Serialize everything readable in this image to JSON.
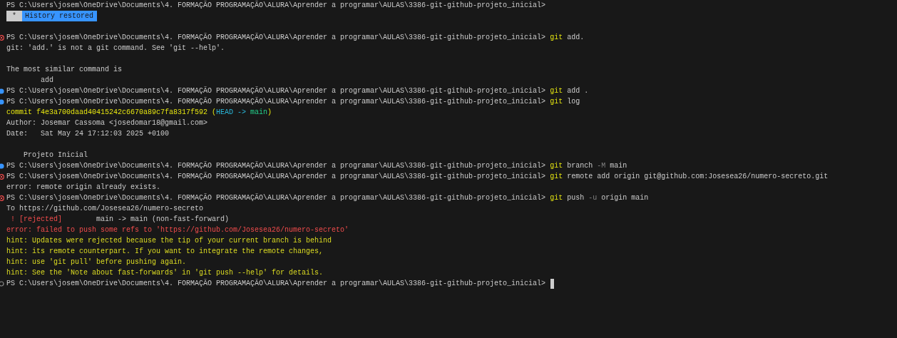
{
  "terminal": {
    "lines": [
      {
        "kind": "prompt",
        "prompt": "PS C:\\Users\\josem\\OneDrive\\Documents\\4. FORMAÇÃO PROGRAMAÇÃO\\ALURA\\Aprender a programar\\AULAS\\3386-git-github-projeto_inicial>"
      },
      {
        "kind": "badge",
        "marker": "*",
        "label": "History restored"
      },
      {
        "kind": "blank"
      },
      {
        "kind": "prompt",
        "decoration": {
          "kind": "error"
        },
        "prompt": "PS C:\\Users\\josem\\OneDrive\\Documents\\4. FORMAÇÃO PROGRAMAÇÃO\\ALURA\\Aprender a programar\\AULAS\\3386-git-github-projeto_inicial>",
        "segments": [
          {
            "text": "git",
            "kind": "command"
          },
          {
            "text": " add.",
            "kind": "default"
          }
        ]
      },
      {
        "kind": "output",
        "segments": [
          {
            "text": "git: 'add.' is not a git command. See 'git --help'.",
            "kind": "default"
          }
        ]
      },
      {
        "kind": "blank"
      },
      {
        "kind": "output",
        "segments": [
          {
            "text": "The most similar command is",
            "kind": "default"
          }
        ]
      },
      {
        "kind": "output",
        "segments": [
          {
            "text": "        add",
            "kind": "default"
          }
        ]
      },
      {
        "kind": "prompt",
        "decoration": {
          "kind": "success"
        },
        "prompt": "PS C:\\Users\\josem\\OneDrive\\Documents\\4. FORMAÇÃO PROGRAMAÇÃO\\ALURA\\Aprender a programar\\AULAS\\3386-git-github-projeto_inicial>",
        "segments": [
          {
            "text": "git",
            "kind": "command"
          },
          {
            "text": " add .",
            "kind": "default"
          }
        ]
      },
      {
        "kind": "prompt",
        "decoration": {
          "kind": "success"
        },
        "prompt": "PS C:\\Users\\josem\\OneDrive\\Documents\\4. FORMAÇÃO PROGRAMAÇÃO\\ALURA\\Aprender a programar\\AULAS\\3386-git-github-projeto_inicial>",
        "segments": [
          {
            "text": "git",
            "kind": "command"
          },
          {
            "text": " log",
            "kind": "default"
          }
        ]
      },
      {
        "kind": "output",
        "segments": [
          {
            "text": "commit f4e3a700daad40415242c6670a89c7fa8317f592 (",
            "kind": "commit"
          },
          {
            "text": "HEAD -> ",
            "kind": "head"
          },
          {
            "text": "main",
            "kind": "branch"
          },
          {
            "text": ")",
            "kind": "commit"
          }
        ]
      },
      {
        "kind": "output",
        "segments": [
          {
            "text": "Author: Josemar Cassoma <josedomar18@gmail.com>",
            "kind": "default"
          }
        ]
      },
      {
        "kind": "output",
        "segments": [
          {
            "text": "Date:   Sat May 24 17:12:03 2025 +0100",
            "kind": "default"
          }
        ]
      },
      {
        "kind": "blank"
      },
      {
        "kind": "output",
        "segments": [
          {
            "text": "    Projeto Inicial",
            "kind": "default"
          }
        ]
      },
      {
        "kind": "prompt",
        "decoration": {
          "kind": "success"
        },
        "prompt": "PS C:\\Users\\josem\\OneDrive\\Documents\\4. FORMAÇÃO PROGRAMAÇÃO\\ALURA\\Aprender a programar\\AULAS\\3386-git-github-projeto_inicial>",
        "segments": [
          {
            "text": "git",
            "kind": "command"
          },
          {
            "text": " branch ",
            "kind": "default"
          },
          {
            "text": "-M",
            "kind": "flag"
          },
          {
            "text": " main",
            "kind": "default"
          }
        ]
      },
      {
        "kind": "prompt",
        "decoration": {
          "kind": "error"
        },
        "prompt": "PS C:\\Users\\josem\\OneDrive\\Documents\\4. FORMAÇÃO PROGRAMAÇÃO\\ALURA\\Aprender a programar\\AULAS\\3386-git-github-projeto_inicial>",
        "segments": [
          {
            "text": "git",
            "kind": "command"
          },
          {
            "text": " remote add origin git@github.com:Josesea26/numero-secreto.git",
            "kind": "default"
          }
        ]
      },
      {
        "kind": "output",
        "segments": [
          {
            "text": "error: remote origin already exists.",
            "kind": "default"
          }
        ]
      },
      {
        "kind": "prompt",
        "decoration": {
          "kind": "error"
        },
        "prompt": "PS C:\\Users\\josem\\OneDrive\\Documents\\4. FORMAÇÃO PROGRAMAÇÃO\\ALURA\\Aprender a programar\\AULAS\\3386-git-github-projeto_inicial>",
        "segments": [
          {
            "text": "git",
            "kind": "command"
          },
          {
            "text": " push ",
            "kind": "default"
          },
          {
            "text": "-u",
            "kind": "flag"
          },
          {
            "text": " origin main",
            "kind": "default"
          }
        ]
      },
      {
        "kind": "output",
        "segments": [
          {
            "text": "To https://github.com/Josesea26/numero-secreto",
            "kind": "default"
          }
        ]
      },
      {
        "kind": "output",
        "segments": [
          {
            "text": " ! [rejected]",
            "kind": "error"
          },
          {
            "text": "        main -> main (non-fast-forward)",
            "kind": "default"
          }
        ]
      },
      {
        "kind": "output",
        "segments": [
          {
            "text": "error: failed to push some refs to 'https://github.com/Josesea26/numero-secreto'",
            "kind": "error"
          }
        ]
      },
      {
        "kind": "output",
        "segments": [
          {
            "text": "hint: Updates were rejected because the tip of your current branch is behind",
            "kind": "hint"
          }
        ]
      },
      {
        "kind": "output",
        "segments": [
          {
            "text": "hint: its remote counterpart. If you want to integrate the remote changes,",
            "kind": "hint"
          }
        ]
      },
      {
        "kind": "output",
        "segments": [
          {
            "text": "hint: use 'git pull' before pushing again.",
            "kind": "hint"
          }
        ]
      },
      {
        "kind": "output",
        "segments": [
          {
            "text": "hint: See the 'Note about fast-forwards' in 'git push --help' for details.",
            "kind": "hint"
          }
        ]
      },
      {
        "kind": "prompt",
        "decoration": {
          "kind": "default"
        },
        "prompt": "PS C:\\Users\\josem\\OneDrive\\Documents\\4. FORMAÇÃO PROGRAMAÇÃO\\ALURA\\Aprender a programar\\AULAS\\3386-git-github-projeto_inicial>",
        "cursor": true
      }
    ]
  }
}
